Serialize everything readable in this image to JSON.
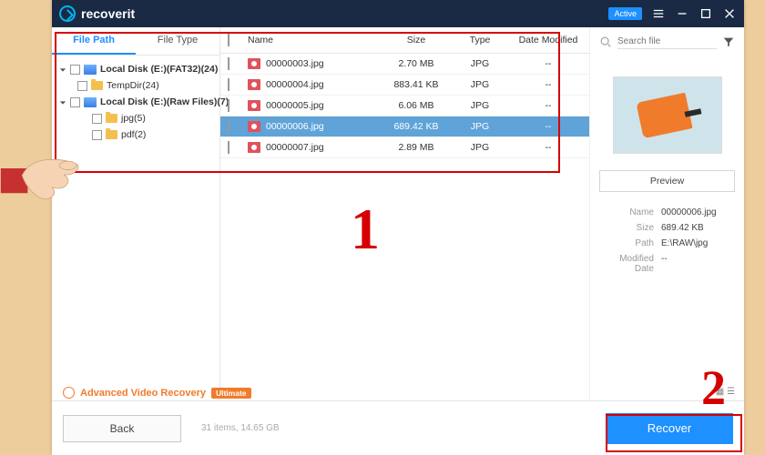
{
  "brand": "recoverit",
  "titlebar": {
    "active_badge": "Active"
  },
  "sidebar": {
    "tabs": {
      "file_path": "File Path",
      "file_type": "File Type"
    },
    "tree": [
      {
        "kind": "disk",
        "label": "Local Disk (E:)(FAT32)(24)",
        "expanded": true,
        "indent": 0,
        "bold": true
      },
      {
        "kind": "folder",
        "label": "TempDir(24)",
        "indent": 1
      },
      {
        "kind": "disk",
        "label": "Local Disk (E:)(Raw Files)(7)",
        "expanded": true,
        "indent": 0,
        "bold": true
      },
      {
        "kind": "folder",
        "label": "jpg(5)",
        "indent": 2
      },
      {
        "kind": "folder",
        "label": "pdf(2)",
        "indent": 2
      }
    ]
  },
  "columns": {
    "name": "Name",
    "size": "Size",
    "type": "Type",
    "date": "Date Modified"
  },
  "files": [
    {
      "name": "00000003.jpg",
      "size": "2.70  MB",
      "type": "JPG",
      "date": "--",
      "selected": false
    },
    {
      "name": "00000004.jpg",
      "size": "883.41  KB",
      "type": "JPG",
      "date": "--",
      "selected": false
    },
    {
      "name": "00000005.jpg",
      "size": "6.06  MB",
      "type": "JPG",
      "date": "--",
      "selected": false
    },
    {
      "name": "00000006.jpg",
      "size": "689.42  KB",
      "type": "JPG",
      "date": "--",
      "selected": true
    },
    {
      "name": "00000007.jpg",
      "size": "2.89  MB",
      "type": "JPG",
      "date": "--",
      "selected": false
    }
  ],
  "search": {
    "placeholder": "Search file"
  },
  "preview_btn": "Preview",
  "meta": {
    "name_k": "Name",
    "name_v": "00000006.jpg",
    "size_k": "Size",
    "size_v": "689.42  KB",
    "path_k": "Path",
    "path_v": "E:\\RAW\\jpg",
    "mod_k": "Modified Date",
    "mod_v": "--"
  },
  "footer": {
    "avr": "Advanced Video Recovery",
    "avr_badge": "Ultimate",
    "status": "31 items, 14.65  GB",
    "back": "Back",
    "recover": "Recover"
  }
}
